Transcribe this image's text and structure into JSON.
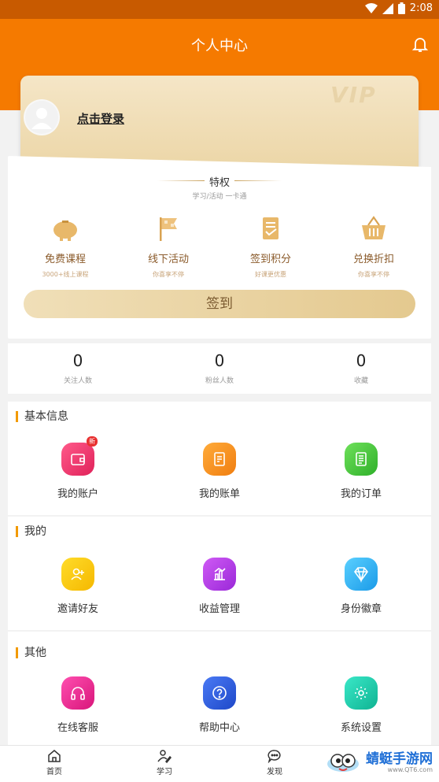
{
  "status_bar": {
    "time": "2:08",
    "wifi_icon": "wifi-icon",
    "signal_icon": "signal-icon",
    "battery_icon": "battery-icon"
  },
  "header": {
    "title": "个人中心",
    "bell_icon": "bell-icon",
    "accent": "#f57a00"
  },
  "card": {
    "login_text": "点击登录",
    "vip_mark": "VIP"
  },
  "privileges": {
    "title": "特权",
    "subtitle": "学习/活动 一卡通",
    "items": [
      {
        "label": "免费课程",
        "sub": "3000+线上课程",
        "icon": "piggy-bank-icon"
      },
      {
        "label": "线下活动",
        "sub": "你喜享不停",
        "icon": "flag-icon"
      },
      {
        "label": "签到积分",
        "sub": "好课更优惠",
        "icon": "checklist-icon"
      },
      {
        "label": "兑换折扣",
        "sub": "你喜享不停",
        "icon": "basket-icon"
      }
    ],
    "sign_button": "签到"
  },
  "stats": [
    {
      "value": "0",
      "label": "关注人数"
    },
    {
      "value": "0",
      "label": "粉丝人数"
    },
    {
      "value": "0",
      "label": "收藏"
    }
  ],
  "sections": {
    "basic": {
      "title": "基本信息",
      "items": [
        {
          "label": "我的账户",
          "icon": "wallet-icon",
          "badge": "新",
          "color": "#e8336b"
        },
        {
          "label": "我的账单",
          "icon": "bill-icon",
          "color": "#f5921e"
        },
        {
          "label": "我的订单",
          "icon": "order-icon",
          "color": "#3fc23a"
        }
      ]
    },
    "mine": {
      "title": "我的",
      "items": [
        {
          "label": "邀请好友",
          "icon": "add-user-icon",
          "color": "#f8c300"
        },
        {
          "label": "收益管理",
          "icon": "chart-icon",
          "color": "#b03be0"
        },
        {
          "label": "身份徽章",
          "icon": "diamond-icon",
          "color": "#2ab0f0"
        }
      ]
    },
    "other": {
      "title": "其他",
      "items": [
        {
          "label": "在线客服",
          "icon": "headphones-icon",
          "color": "#e8288c"
        },
        {
          "label": "帮助中心",
          "icon": "help-icon",
          "color": "#2d5de0"
        },
        {
          "label": "系统设置",
          "icon": "settings-icon",
          "color": "#15c7a8"
        }
      ]
    }
  },
  "nav": [
    {
      "label": "首页",
      "icon": "home-icon"
    },
    {
      "label": "学习",
      "icon": "study-icon"
    },
    {
      "label": "发现",
      "icon": "discover-icon"
    }
  ],
  "watermark": {
    "text": "蜻蜓手游网",
    "url": "www.QT6.com"
  }
}
